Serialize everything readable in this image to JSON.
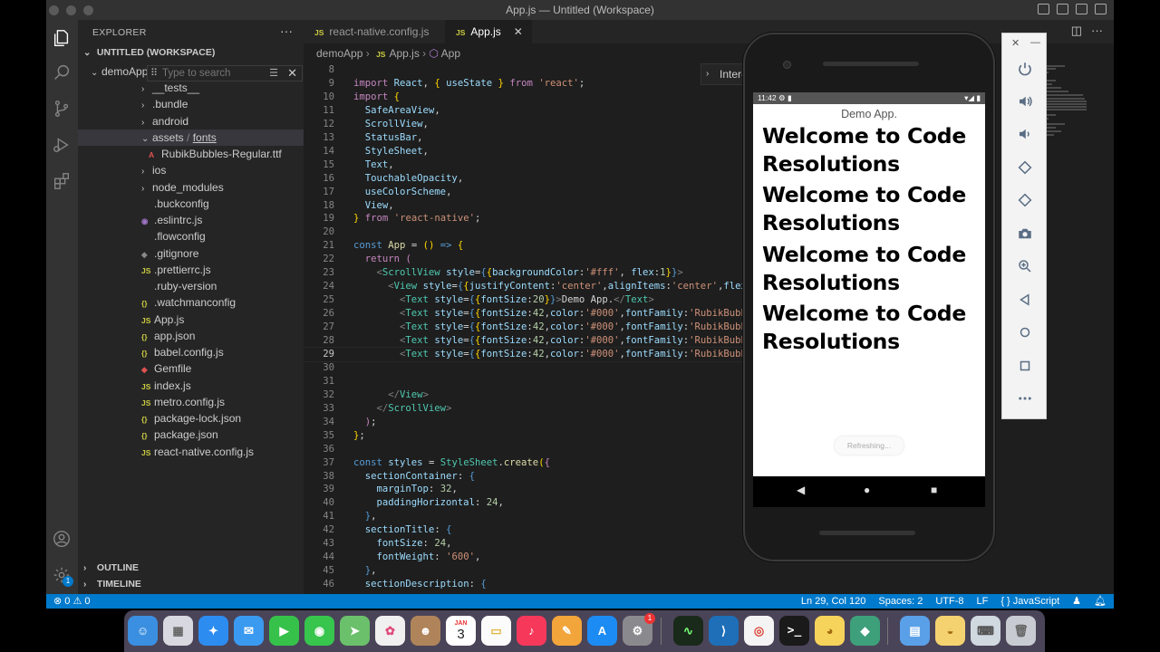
{
  "window": {
    "title": "App.js — Untitled (Workspace)"
  },
  "sidebar": {
    "header": "EXPLORER",
    "more": "···",
    "workspace": "UNTITLED (WORKSPACE)",
    "folder": "demoApp",
    "search_placeholder": "Type to search",
    "items": [
      {
        "label": "__tests__",
        "type": "folder"
      },
      {
        "label": ".bundle",
        "type": "folder"
      },
      {
        "label": "android",
        "type": "folder"
      },
      {
        "label": "assets",
        "sub": "fonts",
        "type": "folder-open"
      },
      {
        "label": "RubikBubbles-Regular.ttf",
        "type": "ttf"
      },
      {
        "label": "ios",
        "type": "folder"
      },
      {
        "label": "node_modules",
        "type": "folder"
      },
      {
        "label": ".buckconfig",
        "type": "plain"
      },
      {
        "label": ".eslintrc.js",
        "type": "eslint"
      },
      {
        "label": ".flowconfig",
        "type": "plain"
      },
      {
        "label": ".gitignore",
        "type": "git"
      },
      {
        "label": ".prettierrc.js",
        "type": "js"
      },
      {
        "label": ".ruby-version",
        "type": "plain"
      },
      {
        "label": ".watchmanconfig",
        "type": "json"
      },
      {
        "label": "App.js",
        "type": "js"
      },
      {
        "label": "app.json",
        "type": "json"
      },
      {
        "label": "babel.config.js",
        "type": "json"
      },
      {
        "label": "Gemfile",
        "type": "gem"
      },
      {
        "label": "index.js",
        "type": "js"
      },
      {
        "label": "metro.config.js",
        "type": "js"
      },
      {
        "label": "package-lock.json",
        "type": "json"
      },
      {
        "label": "package.json",
        "type": "json"
      },
      {
        "label": "react-native.config.js",
        "type": "js"
      }
    ],
    "outline": "OUTLINE",
    "timeline": "TIMELINE"
  },
  "tabs": [
    {
      "label": "react-native.config.js",
      "icon": "JS"
    },
    {
      "label": "App.js",
      "icon": "JS"
    }
  ],
  "breadcrumb": {
    "folder": "demoApp",
    "file": "App.js",
    "symbol": "App"
  },
  "inter_widget": "Inter-",
  "code": {
    "line_numbers": [
      "8",
      "9",
      "10",
      "11",
      "12",
      "13",
      "14",
      "15",
      "16",
      "17",
      "18",
      "19",
      "20",
      "21",
      "22",
      "23",
      "24",
      "25",
      "26",
      "27",
      "28",
      "29",
      "30",
      "31",
      "32",
      "33",
      "34",
      "35",
      "36",
      "37",
      "38",
      "39",
      "40",
      "41",
      "42",
      "43",
      "44",
      "45",
      "46"
    ],
    "current_line": "29"
  },
  "statusbar": {
    "problems": "⊗ 0 ⚠ 0",
    "position": "Ln 29, Col 120",
    "spaces": "Spaces: 2",
    "encoding": "UTF-8",
    "eol": "LF",
    "language": "{ } JavaScript"
  },
  "emulator": {
    "time": "11:42",
    "status_right": "▾◢ ▮",
    "demo_title": "Demo App.",
    "welcome": [
      "Welcome to Code Resolutions",
      "Welcome to Code Resolutions",
      "Welcome to Code Resolutions",
      "Welcome to Code Resolutions"
    ],
    "refreshing": "Refreshing..."
  },
  "dock": {
    "calendar_month": "JAN",
    "calendar_day": "3",
    "badge": "1"
  },
  "colors": {
    "accent": "#007acc",
    "editor_bg": "#1e1e1e",
    "sidebar_bg": "#252526"
  }
}
